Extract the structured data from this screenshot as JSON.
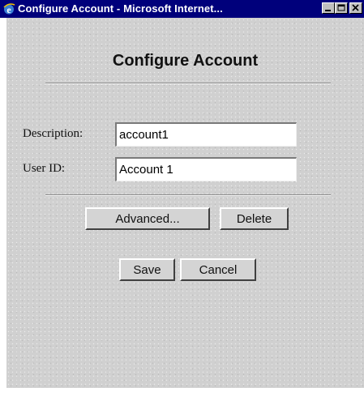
{
  "window": {
    "title": "Configure Account - Microsoft Internet...",
    "title_icon": "ie-logo-icon",
    "controls": {
      "minimize_icon": "minimize-icon",
      "maximize_icon": "maximize-icon",
      "close_icon": "close-icon"
    }
  },
  "form": {
    "heading": "Configure Account",
    "description": {
      "label": "Description:",
      "value": "account1"
    },
    "user_id": {
      "label": "User ID:",
      "value": "Account 1"
    },
    "buttons": {
      "advanced": "Advanced...",
      "delete": "Delete",
      "save": "Save",
      "cancel": "Cancel"
    }
  },
  "colors": {
    "titlebar": "#00007b",
    "client_background": "#d0d0d0",
    "button_face": "#d4d4d4"
  }
}
